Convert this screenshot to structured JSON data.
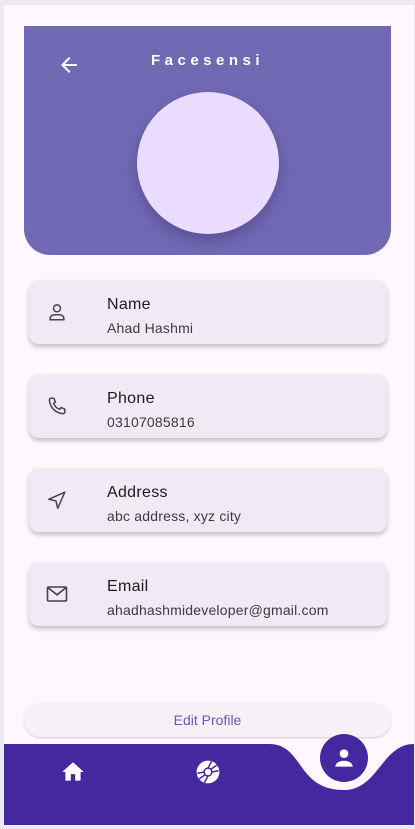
{
  "app": {
    "title": "Facesensi"
  },
  "profile": {
    "fields": [
      {
        "label": "Name",
        "value": "Ahad Hashmi",
        "icon": "person-icon"
      },
      {
        "label": "Phone",
        "value": "03107085816",
        "icon": "phone-icon"
      },
      {
        "label": "Address",
        "value": "abc address, xyz city",
        "icon": "location-icon"
      },
      {
        "label": "Email",
        "value": "ahadhashmideveloper@gmail.com",
        "icon": "mail-icon"
      }
    ]
  },
  "actions": {
    "edit_label": "Edit Profile"
  },
  "nav": {
    "items": [
      {
        "icon": "home-icon"
      },
      {
        "icon": "camera-shutter-icon"
      },
      {
        "icon": "profile-icon",
        "active": true
      }
    ]
  },
  "colors": {
    "header": "#7269b4",
    "avatar": "#eadcff",
    "card": "#efeaf3",
    "navbar": "#4527a0",
    "accent_text": "#6a5aa8"
  }
}
